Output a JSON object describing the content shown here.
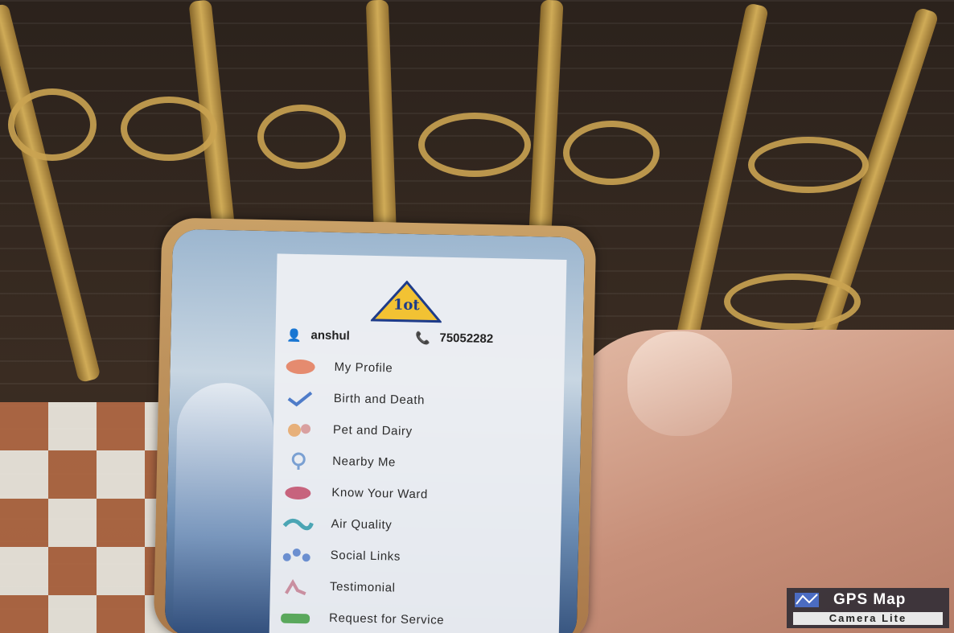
{
  "app": {
    "logo_text": "1ot",
    "user_name": "anshul",
    "phone_number": "75052282"
  },
  "menu": [
    {
      "label": "My Profile",
      "icon": "profile-icon",
      "color": "#e58b6f"
    },
    {
      "label": "Birth and Death",
      "icon": "checkmark-icon",
      "color": "#4f7cc9"
    },
    {
      "label": "Pet and Dairy",
      "icon": "pet-icon",
      "color": "#e7b07a"
    },
    {
      "label": "Nearby Me",
      "icon": "nearby-icon",
      "color": "#7aa0d2"
    },
    {
      "label": "Know Your Ward",
      "icon": "ward-icon",
      "color": "#c7637d"
    },
    {
      "label": "Air Quality",
      "icon": "air-quality-icon",
      "color": "#4ba5b4"
    },
    {
      "label": "Social Links",
      "icon": "social-links-icon",
      "color": "#6b8fd0"
    },
    {
      "label": "Testimonial",
      "icon": "testimonial-icon",
      "color": "#c98fa0"
    },
    {
      "label": "Request for Service",
      "icon": "service-icon",
      "color": "#5aa85c"
    }
  ],
  "watermark": {
    "title": "GPS Map",
    "subtitle": "Camera Lite"
  }
}
